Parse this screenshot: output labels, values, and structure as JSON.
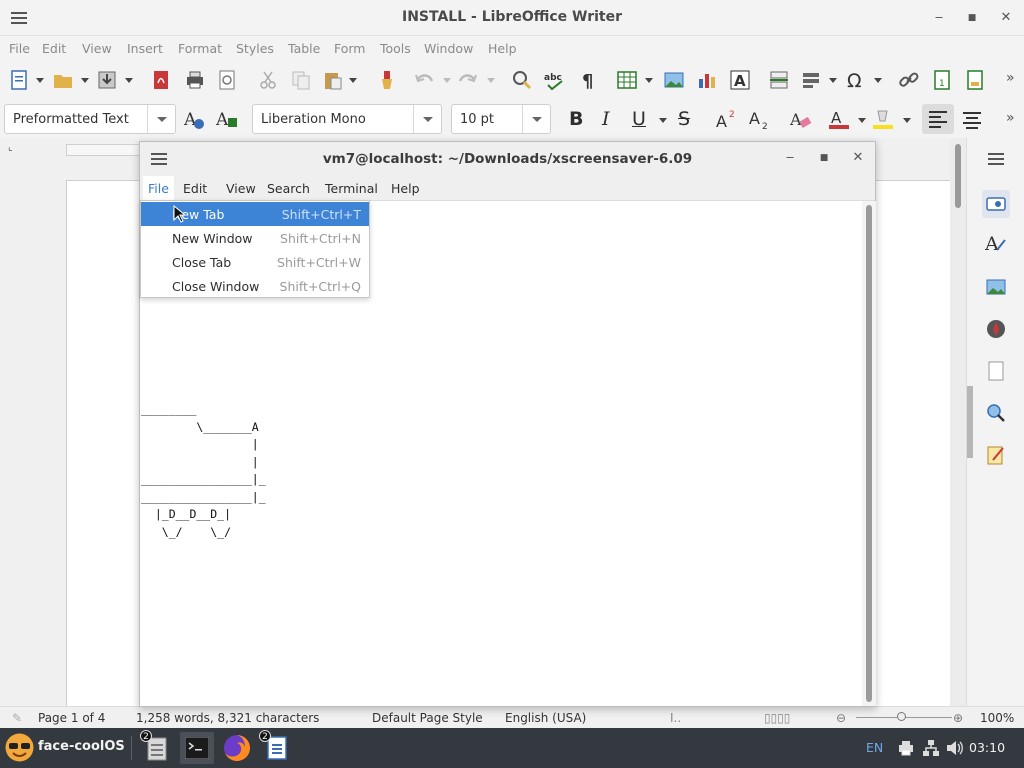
{
  "libreoffice": {
    "title": "INSTALL - LibreOffice Writer",
    "menus": [
      "File",
      "Edit",
      "View",
      "Insert",
      "Format",
      "Styles",
      "Table",
      "Form",
      "Tools",
      "Window",
      "Help"
    ],
    "paragraph_style": "Preformatted Text",
    "font_name": "Liberation Mono",
    "font_size": "10 pt",
    "format_buttons": [
      "B",
      "I",
      "U",
      "S"
    ],
    "status": {
      "page": "Page 1 of 4",
      "words": "1,258 words, 8,321 characters",
      "page_style": "Default Page Style",
      "language": "English (USA)",
      "zoom": "100%"
    }
  },
  "terminal": {
    "title": "vm7@localhost: ~/Downloads/xscreensaver-6.09",
    "menus": [
      "File",
      "Edit",
      "View",
      "Search",
      "Terminal",
      "Help"
    ],
    "file_menu": [
      {
        "label": "New Tab",
        "shortcut": "Shift+Ctrl+T"
      },
      {
        "label": "New Window",
        "shortcut": "Shift+Ctrl+N"
      },
      {
        "label": "Close Tab",
        "shortcut": "Shift+Ctrl+W"
      },
      {
        "label": "Close Window",
        "shortcut": "Shift+Ctrl+Q"
      }
    ],
    "ascii_art": "________\n        \\_______A\n                |\n                |\n________________|_\n________________|_\n  |_D__D__D_|\n   \\_/    \\_/"
  },
  "taskbar": {
    "app_name": "face-coolOS",
    "badge_files": "2",
    "badge_writer": "2",
    "keyboard_layout": "EN",
    "clock": "03:10"
  },
  "colors": {
    "highlight": "#3d84d6",
    "taskbar": "#34393f"
  }
}
